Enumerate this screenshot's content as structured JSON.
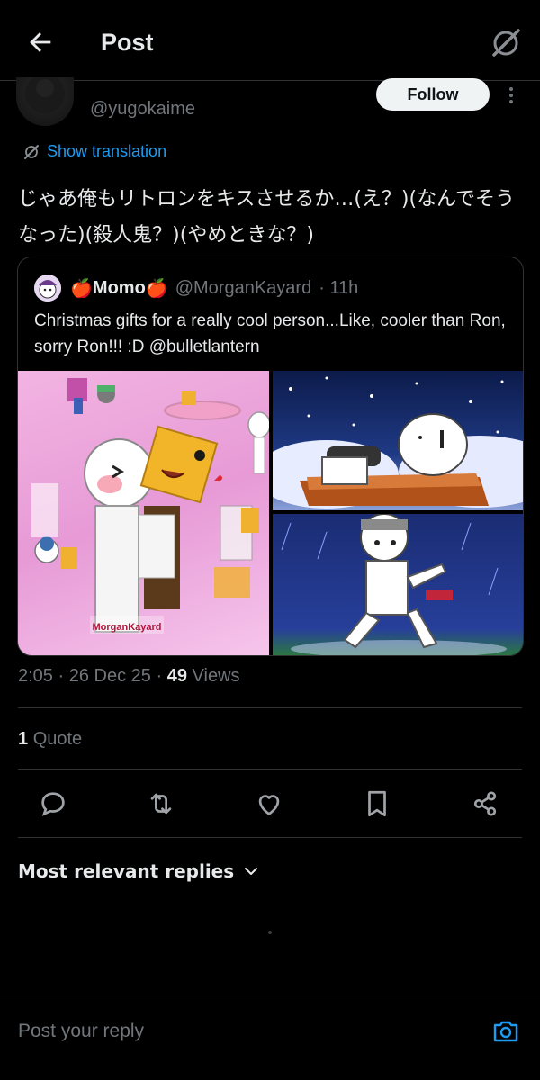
{
  "header": {
    "title": "Post",
    "back_icon": "arrow-left-icon",
    "grok_icon": "grok-slash-icon"
  },
  "author": {
    "handle": "@yugokaime",
    "follow_label": "Follow"
  },
  "translation": {
    "label": "Show translation"
  },
  "post": {
    "text": "じゃあ俺もリトロンをキスさせるか…(え？)(なんでそうなった)(殺人鬼？)(やめときな？)"
  },
  "quoted": {
    "name": "Momo",
    "name_emoji": "🍎",
    "handle": "@MorganKayard",
    "time": "· 11h",
    "text": "Christmas gifts for a really cool person...Like, cooler than Ron, sorry Ron!!! :D @bulletlantern",
    "watermark": "MorganKayard"
  },
  "meta": {
    "time": "2:05",
    "sep1": "·",
    "date": "26 Dec 25",
    "sep2": "·",
    "views_count": "49",
    "views_label": "Views"
  },
  "quotes": {
    "count": "1",
    "label": "Quote"
  },
  "actions": [
    "reply-icon",
    "repost-icon",
    "like-icon",
    "bookmark-icon",
    "share-icon"
  ],
  "replies": {
    "sort_label": "Most relevant replies"
  },
  "reply_box": {
    "placeholder": "Post your reply"
  },
  "colors": {
    "accent": "#1d9bf0",
    "background": "#000000",
    "text": "#e7e9ea",
    "muted": "#71767b",
    "border": "#2f3336"
  }
}
